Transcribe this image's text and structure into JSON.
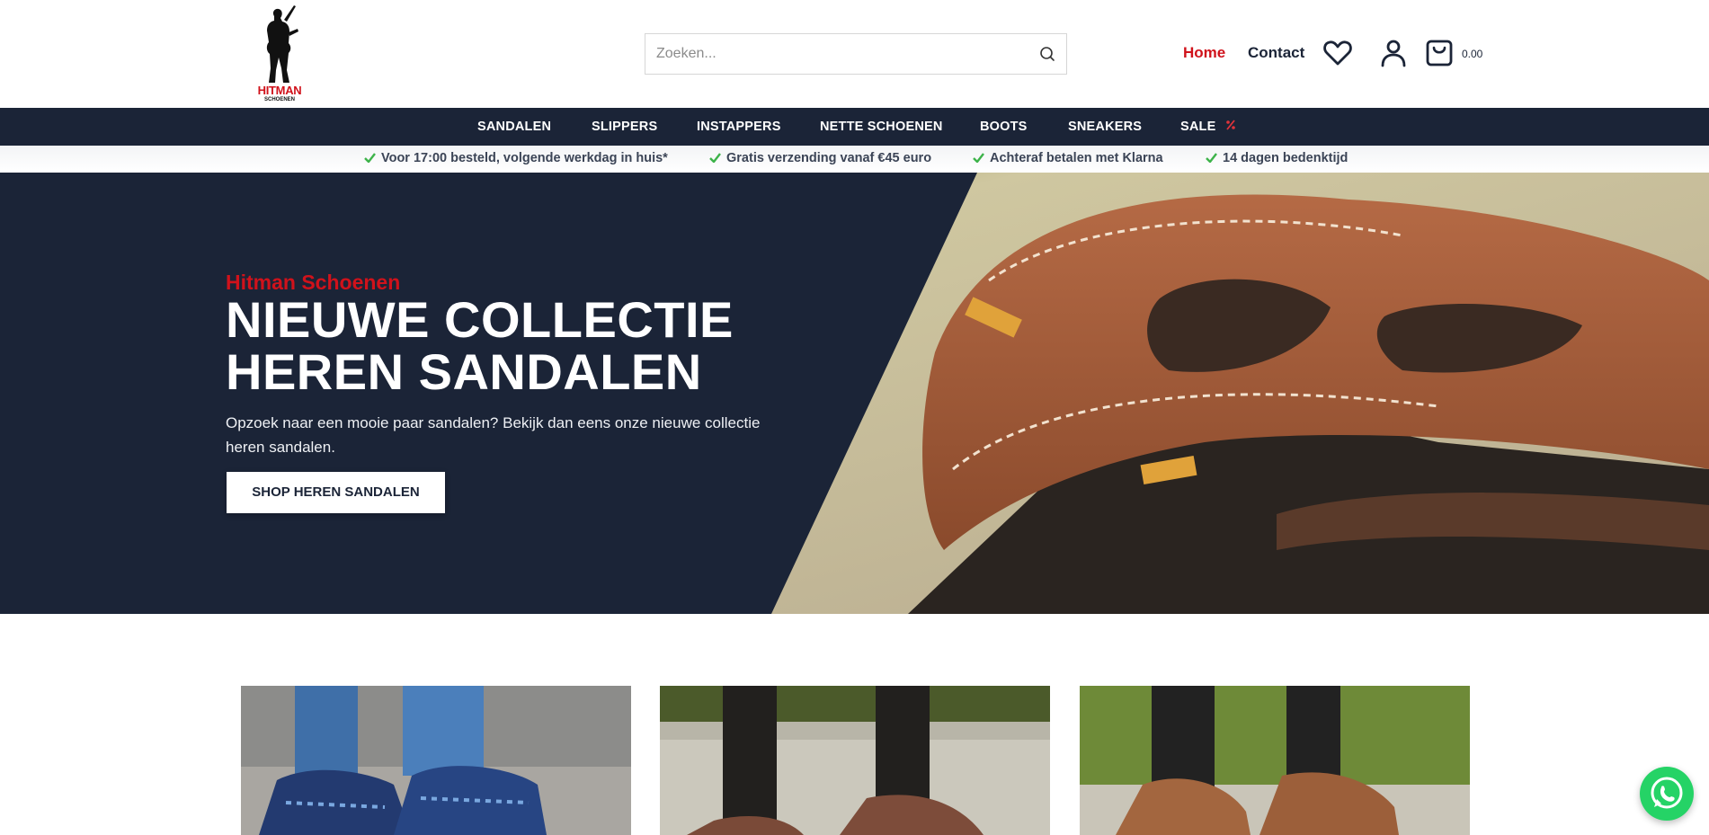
{
  "brand": {
    "name": "HITMAN",
    "tagline": "SCHOENEN"
  },
  "search": {
    "placeholder": "Zoeken..."
  },
  "header": {
    "nav": [
      {
        "label": "Home",
        "active": true
      },
      {
        "label": "Contact",
        "active": false
      }
    ],
    "cart_total": "0.00"
  },
  "categories": [
    "SANDALEN",
    "SLIPPERS",
    "INSTAPPERS",
    "NETTE SCHOENEN",
    "BOOTS",
    "SNEAKERS",
    "SALE"
  ],
  "usps": [
    "Voor 17:00 besteld, volgende werkdag in huis*",
    "Gratis verzending vanaf €45 euro",
    "Achteraf betalen met Klarna",
    "14 dagen bedenktijd"
  ],
  "hero": {
    "subtitle": "Hitman Schoenen",
    "title_line1": "NIEUWE COLLECTIE",
    "title_line2": "HEREN SANDALEN",
    "description": "Opzoek naar een mooie paar sandalen? Bekijk dan eens onze nieuwe collectie heren sandalen.",
    "cta": "SHOP HEREN SANDALEN"
  },
  "icons": {
    "search": "search-icon",
    "wishlist": "heart-icon",
    "account": "user-icon",
    "cart": "shopping-bag-icon",
    "usp": "check-icon",
    "sale": "percent-icon",
    "chat": "whatsapp-icon"
  },
  "colors": {
    "navy": "#1b2437",
    "accent_red": "#d0121b",
    "check_green": "#3db34a",
    "whatsapp_green": "#25d366"
  }
}
